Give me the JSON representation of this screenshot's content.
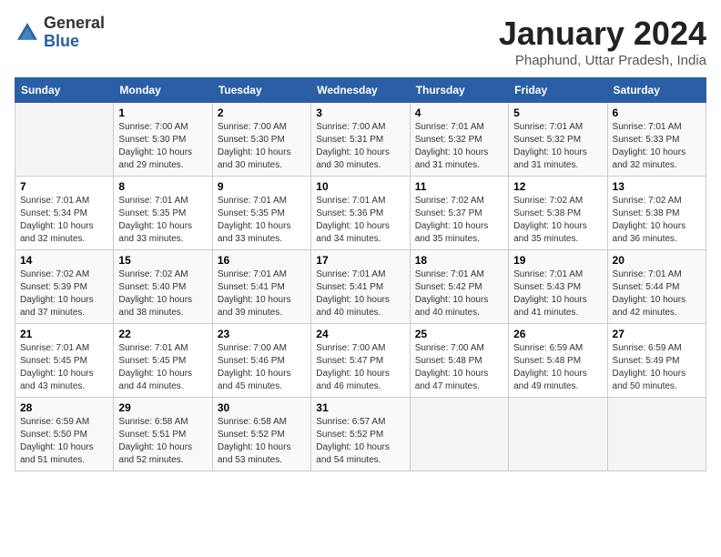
{
  "header": {
    "logo_general": "General",
    "logo_blue": "Blue",
    "title": "January 2024",
    "subtitle": "Phaphund, Uttar Pradesh, India"
  },
  "weekdays": [
    "Sunday",
    "Monday",
    "Tuesday",
    "Wednesday",
    "Thursday",
    "Friday",
    "Saturday"
  ],
  "weeks": [
    [
      {
        "day": "",
        "sunrise": "",
        "sunset": "",
        "daylight": ""
      },
      {
        "day": "1",
        "sunrise": "7:00 AM",
        "sunset": "5:30 PM",
        "daylight": "10 hours and 29 minutes."
      },
      {
        "day": "2",
        "sunrise": "7:00 AM",
        "sunset": "5:30 PM",
        "daylight": "10 hours and 30 minutes."
      },
      {
        "day": "3",
        "sunrise": "7:00 AM",
        "sunset": "5:31 PM",
        "daylight": "10 hours and 30 minutes."
      },
      {
        "day": "4",
        "sunrise": "7:01 AM",
        "sunset": "5:32 PM",
        "daylight": "10 hours and 31 minutes."
      },
      {
        "day": "5",
        "sunrise": "7:01 AM",
        "sunset": "5:32 PM",
        "daylight": "10 hours and 31 minutes."
      },
      {
        "day": "6",
        "sunrise": "7:01 AM",
        "sunset": "5:33 PM",
        "daylight": "10 hours and 32 minutes."
      }
    ],
    [
      {
        "day": "7",
        "sunrise": "7:01 AM",
        "sunset": "5:34 PM",
        "daylight": "10 hours and 32 minutes."
      },
      {
        "day": "8",
        "sunrise": "7:01 AM",
        "sunset": "5:35 PM",
        "daylight": "10 hours and 33 minutes."
      },
      {
        "day": "9",
        "sunrise": "7:01 AM",
        "sunset": "5:35 PM",
        "daylight": "10 hours and 33 minutes."
      },
      {
        "day": "10",
        "sunrise": "7:01 AM",
        "sunset": "5:36 PM",
        "daylight": "10 hours and 34 minutes."
      },
      {
        "day": "11",
        "sunrise": "7:02 AM",
        "sunset": "5:37 PM",
        "daylight": "10 hours and 35 minutes."
      },
      {
        "day": "12",
        "sunrise": "7:02 AM",
        "sunset": "5:38 PM",
        "daylight": "10 hours and 35 minutes."
      },
      {
        "day": "13",
        "sunrise": "7:02 AM",
        "sunset": "5:38 PM",
        "daylight": "10 hours and 36 minutes."
      }
    ],
    [
      {
        "day": "14",
        "sunrise": "7:02 AM",
        "sunset": "5:39 PM",
        "daylight": "10 hours and 37 minutes."
      },
      {
        "day": "15",
        "sunrise": "7:02 AM",
        "sunset": "5:40 PM",
        "daylight": "10 hours and 38 minutes."
      },
      {
        "day": "16",
        "sunrise": "7:01 AM",
        "sunset": "5:41 PM",
        "daylight": "10 hours and 39 minutes."
      },
      {
        "day": "17",
        "sunrise": "7:01 AM",
        "sunset": "5:41 PM",
        "daylight": "10 hours and 40 minutes."
      },
      {
        "day": "18",
        "sunrise": "7:01 AM",
        "sunset": "5:42 PM",
        "daylight": "10 hours and 40 minutes."
      },
      {
        "day": "19",
        "sunrise": "7:01 AM",
        "sunset": "5:43 PM",
        "daylight": "10 hours and 41 minutes."
      },
      {
        "day": "20",
        "sunrise": "7:01 AM",
        "sunset": "5:44 PM",
        "daylight": "10 hours and 42 minutes."
      }
    ],
    [
      {
        "day": "21",
        "sunrise": "7:01 AM",
        "sunset": "5:45 PM",
        "daylight": "10 hours and 43 minutes."
      },
      {
        "day": "22",
        "sunrise": "7:01 AM",
        "sunset": "5:45 PM",
        "daylight": "10 hours and 44 minutes."
      },
      {
        "day": "23",
        "sunrise": "7:00 AM",
        "sunset": "5:46 PM",
        "daylight": "10 hours and 45 minutes."
      },
      {
        "day": "24",
        "sunrise": "7:00 AM",
        "sunset": "5:47 PM",
        "daylight": "10 hours and 46 minutes."
      },
      {
        "day": "25",
        "sunrise": "7:00 AM",
        "sunset": "5:48 PM",
        "daylight": "10 hours and 47 minutes."
      },
      {
        "day": "26",
        "sunrise": "6:59 AM",
        "sunset": "5:48 PM",
        "daylight": "10 hours and 49 minutes."
      },
      {
        "day": "27",
        "sunrise": "6:59 AM",
        "sunset": "5:49 PM",
        "daylight": "10 hours and 50 minutes."
      }
    ],
    [
      {
        "day": "28",
        "sunrise": "6:59 AM",
        "sunset": "5:50 PM",
        "daylight": "10 hours and 51 minutes."
      },
      {
        "day": "29",
        "sunrise": "6:58 AM",
        "sunset": "5:51 PM",
        "daylight": "10 hours and 52 minutes."
      },
      {
        "day": "30",
        "sunrise": "6:58 AM",
        "sunset": "5:52 PM",
        "daylight": "10 hours and 53 minutes."
      },
      {
        "day": "31",
        "sunrise": "6:57 AM",
        "sunset": "5:52 PM",
        "daylight": "10 hours and 54 minutes."
      },
      {
        "day": "",
        "sunrise": "",
        "sunset": "",
        "daylight": ""
      },
      {
        "day": "",
        "sunrise": "",
        "sunset": "",
        "daylight": ""
      },
      {
        "day": "",
        "sunrise": "",
        "sunset": "",
        "daylight": ""
      }
    ]
  ]
}
